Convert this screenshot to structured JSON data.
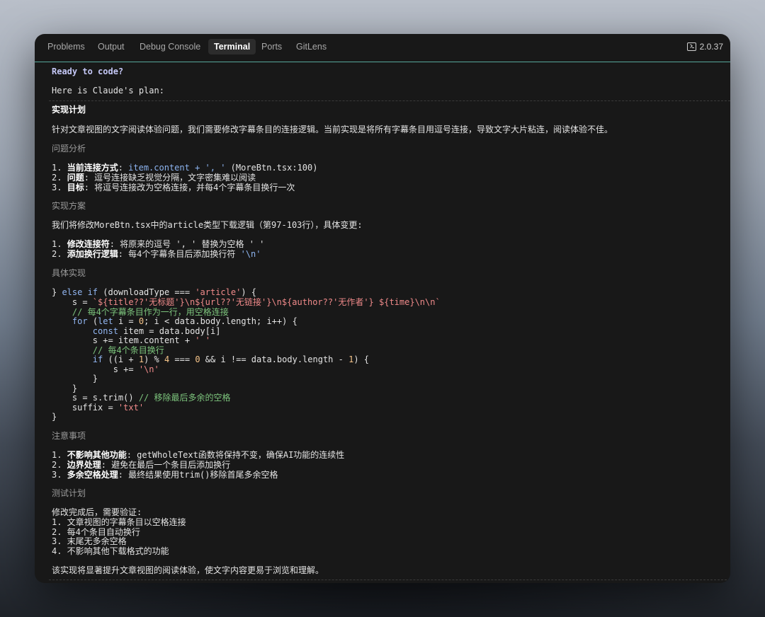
{
  "tabs": [
    {
      "label": "Problems",
      "active": false
    },
    {
      "label": "Output",
      "active": false
    },
    {
      "label": "Debug Console",
      "active": false
    },
    {
      "label": "Terminal",
      "active": true
    },
    {
      "label": "Ports",
      "active": false
    },
    {
      "label": "GitLens",
      "active": false
    }
  ],
  "version": "2.0.37",
  "terminal": {
    "ready": "Ready to code?",
    "intro": "Here is Claude's plan:",
    "plan_title": "实现计划",
    "summary": "针对文章视图的文字阅读体验问题，我们需要修改字幕条目的连接逻辑。当前实现是将所有字幕条目用逗号连接，导致文字大片粘连，阅读体验不佳。",
    "sec1": "问题分析",
    "l1a": "当前连接方式",
    "l1b": ": ",
    "l1c": "item.content + ', '",
    "l1d": " (MoreBtn.tsx:100)",
    "l2a": "问题",
    "l2b": ": 逗号连接缺乏视觉分隔，文字密集难以阅读",
    "l3a": "目标",
    "l3b": ": 将逗号连接改为空格连接，并每4个字幕条目换行一次",
    "sec2": "实现方案",
    "approach": "我们将修改MoreBtn.tsx中的article类型下载逻辑（第97-103行），具体变更:",
    "m1a": "修改连接符",
    "m1b": ": 将原来的逗号 ', ' 替换为空格 ' '",
    "m2a": "添加换行逻辑",
    "m2b": ": 每4个字幕条目后添加换行符 ",
    "m2c": "'\\n'",
    "sec3": "具体实现",
    "code": {
      "c1a": "} ",
      "c1b": "else if",
      "c1c": " (downloadType === ",
      "c1d": "'article'",
      "c1e": ") {",
      "c2a": "    s = ",
      "c2b": "`${title??'无标题'}\\n${url??'无链接'}\\n${author??'无作者'} ${time}\\n\\n`",
      "c3": "    // 每4个字幕条目作为一行，用空格连接",
      "c4a": "    ",
      "c4b": "for",
      "c4c": " (",
      "c4d": "let",
      "c4e": " i = ",
      "c4f": "0",
      "c4g": "; i < data.body.length; i++) {",
      "c5a": "        ",
      "c5b": "const",
      "c5c": " item = data.body[i]",
      "c6a": "        s += item.content + ",
      "c6b": "' '",
      "c7": "        // 每4个条目换行",
      "c8a": "        ",
      "c8b": "if",
      "c8c": " ((i + ",
      "c8d": "1",
      "c8e": ") % ",
      "c8f": "4",
      "c8g": " === ",
      "c8h": "0",
      "c8i": " && i !== data.body.length - ",
      "c8j": "1",
      "c8k": ") {",
      "c9a": "            s += ",
      "c9b": "'\\n'",
      "c10": "        }",
      "c11": "    }",
      "c12a": "    s = s.trim() ",
      "c12b": "// 移除最后多余的空格",
      "c13a": "    suffix = ",
      "c13b": "'txt'",
      "c14": "}"
    },
    "sec4": "注意事项",
    "n1a": "不影响其他功能",
    "n1b": ": getWholeText函数将保持不变，确保AI功能的连续性",
    "n2a": "边界处理",
    "n2b": ": 避免在最后一个条目后添加换行",
    "n3a": "多余空格处理",
    "n3b": ": 最终结果使用trim()移除首尾多余空格",
    "sec5": "测试计划",
    "t0": "修改完成后，需要验证:",
    "t1": "1. 文章视图的字幕条目以空格连接",
    "t2": "2. 每4个条目自动换行",
    "t3": "3. 末尾无多余空格",
    "t4": "4. 不影响其他下载格式的功能",
    "closing": "该实现将显著提升文章视图的阅读体验，使文字内容更易于浏览和理解。"
  }
}
